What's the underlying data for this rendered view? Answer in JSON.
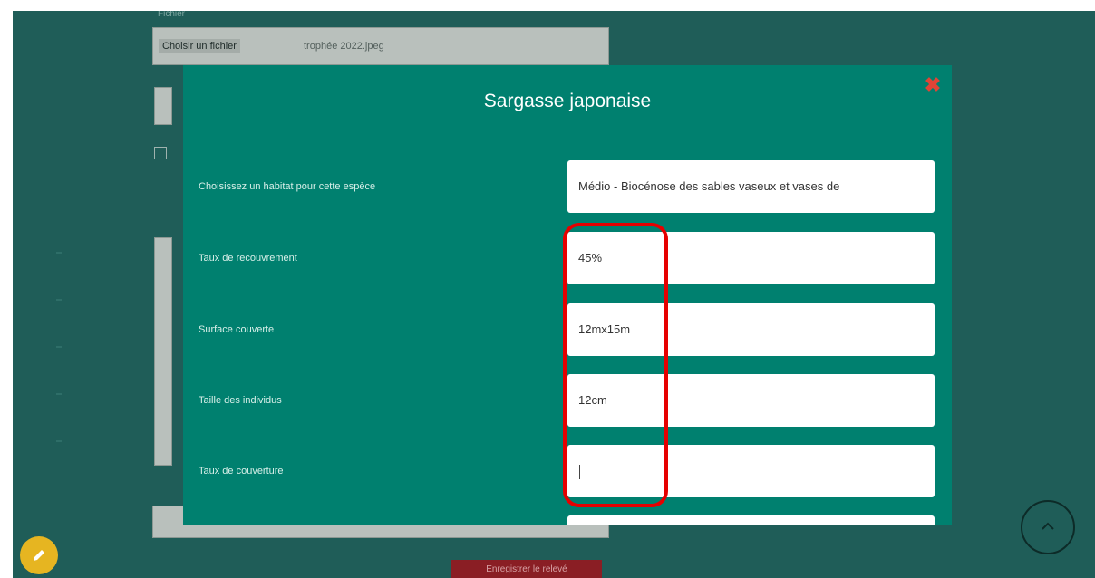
{
  "background": {
    "file_button_label": "Choisir un fichier",
    "file_name": "trophée 2022.jpeg",
    "bottom_button_label": "Enregistrer le relevé"
  },
  "modal": {
    "title": "Sargasse japonaise",
    "close_glyph": "✖",
    "fields": [
      {
        "label": "Choisissez un habitat pour cette espèce",
        "value": "Médio - Biocénose des sables vaseux et vases de"
      },
      {
        "label": "Taux de recouvrement",
        "value": "45%"
      },
      {
        "label": "Surface couverte",
        "value": "12mx15m"
      },
      {
        "label": "Taille des individus",
        "value": "12cm"
      },
      {
        "label": "Taux de couverture",
        "value": ""
      },
      {
        "label": "",
        "value": ""
      }
    ]
  },
  "colors": {
    "backdrop": "#1f5d58",
    "modal": "#00806f",
    "close": "#e04436",
    "highlight": "#e60000",
    "fab_left": "#e6b521"
  },
  "icons": {
    "close": "close-icon",
    "fab_left": "edit-icon",
    "fab_right": "scroll-icon"
  }
}
